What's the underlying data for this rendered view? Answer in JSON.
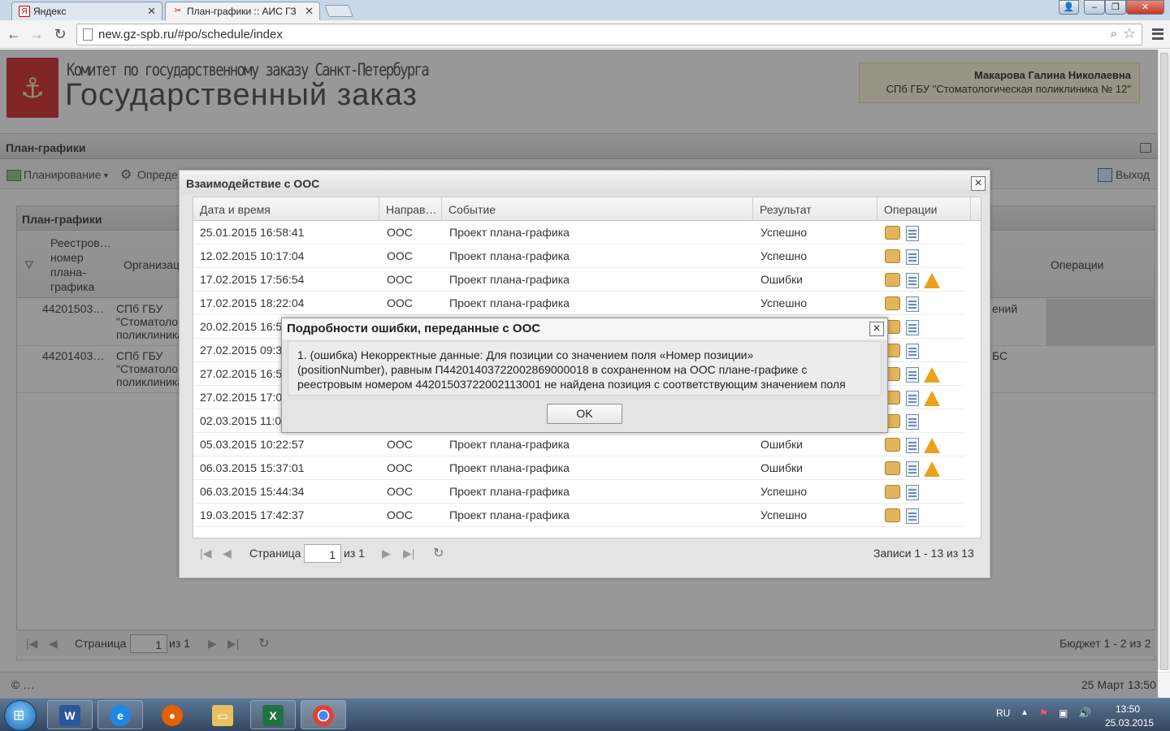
{
  "browser": {
    "tabs": [
      {
        "label": "Яндекс",
        "active": false
      },
      {
        "label": "План-графики :: АИС ГЗ",
        "active": true
      }
    ],
    "url": "new.gz-spb.ru/#po/schedule/index"
  },
  "header": {
    "org_line1": "Комитет по государственному заказу Санкт-Петербурга",
    "org_line2": "Государственный заказ",
    "user_name": "Макарова Галина Николаевна",
    "user_org": "СПб ГБУ \"Стоматологическая поликлиника № 12\""
  },
  "page": {
    "section_title": "План-графики",
    "toolbar": {
      "planning": "Планирование",
      "define": "Опреде",
      "exit": "Выход"
    },
    "panel_title": "План-графики",
    "columns": {
      "registry": "Реестров… номер плана-графика",
      "organization": "Организац",
      "operations": "Операции"
    },
    "rows": [
      {
        "num": "44201503…",
        "org": "СПб ГБУ \"Стоматоло поликлиника",
        "tail": "ений"
      },
      {
        "num": "44201403…",
        "org": "СПб ГБУ \"Стоматоло поликлиника",
        "tail": "БС"
      }
    ],
    "pager": {
      "page_label": "Страница",
      "page": "1",
      "of": "из 1",
      "summary": "Бюджет 1 - 2 из 2"
    },
    "footer": {
      "left": "© …",
      "right": "25 Март 13:50"
    }
  },
  "dialog": {
    "title": "Взаимодействие с ООС",
    "columns": {
      "date": "Дата и время",
      "dir": "Направ…",
      "event": "Событие",
      "result": "Результат",
      "ops": "Операции"
    },
    "rows": [
      {
        "date": "25.01.2015 16:58:41",
        "dir": "ООС",
        "event": "Проект плана-графика",
        "result": "Успешно",
        "warn": false
      },
      {
        "date": "12.02.2015 10:17:04",
        "dir": "ООС",
        "event": "Проект плана-графика",
        "result": "Успешно",
        "warn": false
      },
      {
        "date": "17.02.2015 17:56:54",
        "dir": "ООС",
        "event": "Проект плана-графика",
        "result": "Ошибки",
        "warn": true
      },
      {
        "date": "17.02.2015 18:22:04",
        "dir": "ООС",
        "event": "Проект плана-графика",
        "result": "Успешно",
        "warn": false
      },
      {
        "date": "20.02.2015 16:5",
        "dir": "",
        "event": "",
        "result": "",
        "warn": false
      },
      {
        "date": "27.02.2015 09:3",
        "dir": "",
        "event": "",
        "result": "",
        "warn": false
      },
      {
        "date": "27.02.2015 16:5",
        "dir": "",
        "event": "",
        "result": "",
        "warn": true
      },
      {
        "date": "27.02.2015 17:0",
        "dir": "",
        "event": "",
        "result": "",
        "warn": true
      },
      {
        "date": "02.03.2015 11:0",
        "dir": "",
        "event": "",
        "result": "",
        "warn": false
      },
      {
        "date": "05.03.2015 10:22:57",
        "dir": "ООС",
        "event": "Проект плана-графика",
        "result": "Ошибки",
        "warn": true
      },
      {
        "date": "06.03.2015 15:37:01",
        "dir": "ООС",
        "event": "Проект плана-графика",
        "result": "Ошибки",
        "warn": true
      },
      {
        "date": "06.03.2015 15:44:34",
        "dir": "ООС",
        "event": "Проект плана-графика",
        "result": "Успешно",
        "warn": false
      },
      {
        "date": "19.03.2015 17:42:37",
        "dir": "ООС",
        "event": "Проект плана-графика",
        "result": "Успешно",
        "warn": false
      }
    ],
    "pager": {
      "page_label": "Страница",
      "page": "1",
      "of": "из 1",
      "summary": "Записи 1 - 13 из 13"
    }
  },
  "error_dialog": {
    "title": "Подробности ошибки, переданные с ООС",
    "line1": "1. (ошибка) Некорректные данные: Для позиции со значением поля «Номер позиции»",
    "line2": "(positionNumber), равным П44201403722002869000018 в сохраненном на ООС плане-графике с",
    "line3": "реестровым номером 44201503722002113001 не найдена позиция с соответствующим значением поля",
    "ok": "OK"
  },
  "taskbar": {
    "lang": "RU",
    "time": "13:50",
    "date": "25.03.2015"
  },
  "colors": {
    "accent": "#d2232a",
    "warn": "#e9a21c",
    "userbox": "#fff9df"
  }
}
